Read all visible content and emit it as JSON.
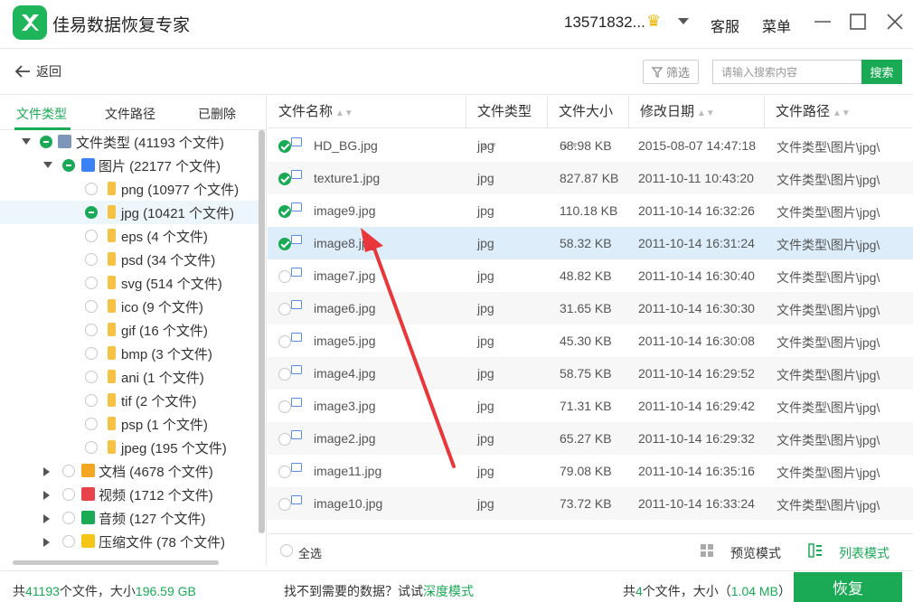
{
  "app": {
    "title": "佳易数据恢复专家",
    "account": "13571832...",
    "service": "客服",
    "menu": "菜单"
  },
  "toolbar": {
    "back": "返回",
    "filter": "筛选",
    "search_placeholder": "请输入搜索内容",
    "search_button": "搜索"
  },
  "left_tabs": [
    "文件类型",
    "文件路径",
    "已删除"
  ],
  "tree": [
    {
      "label": "文件类型 (41193 个文件)",
      "level": 0,
      "expanded": true,
      "state": "partial",
      "icon": "drive-icon"
    },
    {
      "label": "图片 (22177 个文件)",
      "level": 1,
      "expanded": true,
      "state": "partial",
      "icon": "image-folder-icon"
    },
    {
      "label": "png (10977 个文件)",
      "level": 2,
      "state": "none"
    },
    {
      "label": "jpg (10421 个文件)",
      "level": 2,
      "state": "partial",
      "selected": true
    },
    {
      "label": "eps (4 个文件)",
      "level": 2,
      "state": "none"
    },
    {
      "label": "psd (34 个文件)",
      "level": 2,
      "state": "none"
    },
    {
      "label": "svg (514 个文件)",
      "level": 2,
      "state": "none"
    },
    {
      "label": "ico (9 个文件)",
      "level": 2,
      "state": "none"
    },
    {
      "label": "gif (16 个文件)",
      "level": 2,
      "state": "none"
    },
    {
      "label": "bmp (3 个文件)",
      "level": 2,
      "state": "none"
    },
    {
      "label": "ani (1 个文件)",
      "level": 2,
      "state": "none"
    },
    {
      "label": "tif (2 个文件)",
      "level": 2,
      "state": "none"
    },
    {
      "label": "psp (1 个文件)",
      "level": 2,
      "state": "none"
    },
    {
      "label": "jpeg (195 个文件)",
      "level": 2,
      "state": "none"
    },
    {
      "label": "文档 (4678 个文件)",
      "level": 1,
      "expanded": false,
      "state": "none",
      "icon": "document-folder-icon",
      "color": "#f5a623"
    },
    {
      "label": "视频 (1712 个文件)",
      "level": 1,
      "expanded": false,
      "state": "none",
      "icon": "video-folder-icon",
      "color": "#e8424a"
    },
    {
      "label": "音频 (127 个文件)",
      "level": 1,
      "expanded": false,
      "state": "none",
      "icon": "audio-folder-icon",
      "color": "#1aaa55"
    },
    {
      "label": "压缩文件 (78 个文件)",
      "level": 1,
      "expanded": false,
      "state": "none",
      "icon": "archive-folder-icon",
      "color": "#f5c518"
    }
  ],
  "table": {
    "columns": [
      "文件名称",
      "文件类型",
      "文件大小",
      "修改日期",
      "文件路径"
    ],
    "rows": [
      {
        "name": "HD_BG.jpg",
        "type": "jpg",
        "size": "68.98 KB",
        "date": "2015-08-07 14:47:18",
        "path": "文件类型\\图片\\jpg\\",
        "checked": true
      },
      {
        "name": "texture1.jpg",
        "type": "jpg",
        "size": "827.87 KB",
        "date": "2011-10-11 10:43:20",
        "path": "文件类型\\图片\\jpg\\",
        "checked": true
      },
      {
        "name": "image9.jpg",
        "type": "jpg",
        "size": "110.18 KB",
        "date": "2011-10-14 16:32:26",
        "path": "文件类型\\图片\\jpg\\",
        "checked": true
      },
      {
        "name": "image8.jpg",
        "type": "jpg",
        "size": "58.32 KB",
        "date": "2011-10-14 16:31:24",
        "path": "文件类型\\图片\\jpg\\",
        "checked": true
      },
      {
        "name": "image7.jpg",
        "type": "jpg",
        "size": "48.82 KB",
        "date": "2011-10-14 16:30:40",
        "path": "文件类型\\图片\\jpg\\",
        "checked": false
      },
      {
        "name": "image6.jpg",
        "type": "jpg",
        "size": "31.65 KB",
        "date": "2011-10-14 16:30:30",
        "path": "文件类型\\图片\\jpg\\",
        "checked": false
      },
      {
        "name": "image5.jpg",
        "type": "jpg",
        "size": "45.30 KB",
        "date": "2011-10-14 16:30:08",
        "path": "文件类型\\图片\\jpg\\",
        "checked": false
      },
      {
        "name": "image4.jpg",
        "type": "jpg",
        "size": "58.75 KB",
        "date": "2011-10-14 16:29:52",
        "path": "文件类型\\图片\\jpg\\",
        "checked": false
      },
      {
        "name": "image3.jpg",
        "type": "jpg",
        "size": "71.31 KB",
        "date": "2011-10-14 16:29:42",
        "path": "文件类型\\图片\\jpg\\",
        "checked": false
      },
      {
        "name": "image2.jpg",
        "type": "jpg",
        "size": "65.27 KB",
        "date": "2011-10-14 16:29:32",
        "path": "文件类型\\图片\\jpg\\",
        "checked": false
      },
      {
        "name": "image11.jpg",
        "type": "jpg",
        "size": "79.08 KB",
        "date": "2011-10-14 16:35:16",
        "path": "文件类型\\图片\\jpg\\",
        "checked": false
      },
      {
        "name": "image10.jpg",
        "type": "jpg",
        "size": "73.72 KB",
        "date": "2011-10-14 16:33:24",
        "path": "文件类型\\图片\\jpg\\",
        "checked": false
      }
    ]
  },
  "footer": {
    "select_all": "全选",
    "preview_mode": "预览模式",
    "list_mode": "列表模式"
  },
  "status": {
    "left_prefix": "共",
    "total_files": "41193",
    "left_mid": "个文件，大小",
    "total_size": "196.59 GB",
    "hint": "找不到需要的数据？试试",
    "deep_mode": "深度模式",
    "sel_prefix": "共",
    "sel_count": "4",
    "sel_mid": "个文件，大小（",
    "sel_size": "1.04 MB",
    "sel_suffix": "）",
    "recover": "恢复"
  },
  "colors": {
    "accent": "#1aaa55",
    "highlight_row": "#ddeefa",
    "annotation_arrow": "#e8363a"
  }
}
